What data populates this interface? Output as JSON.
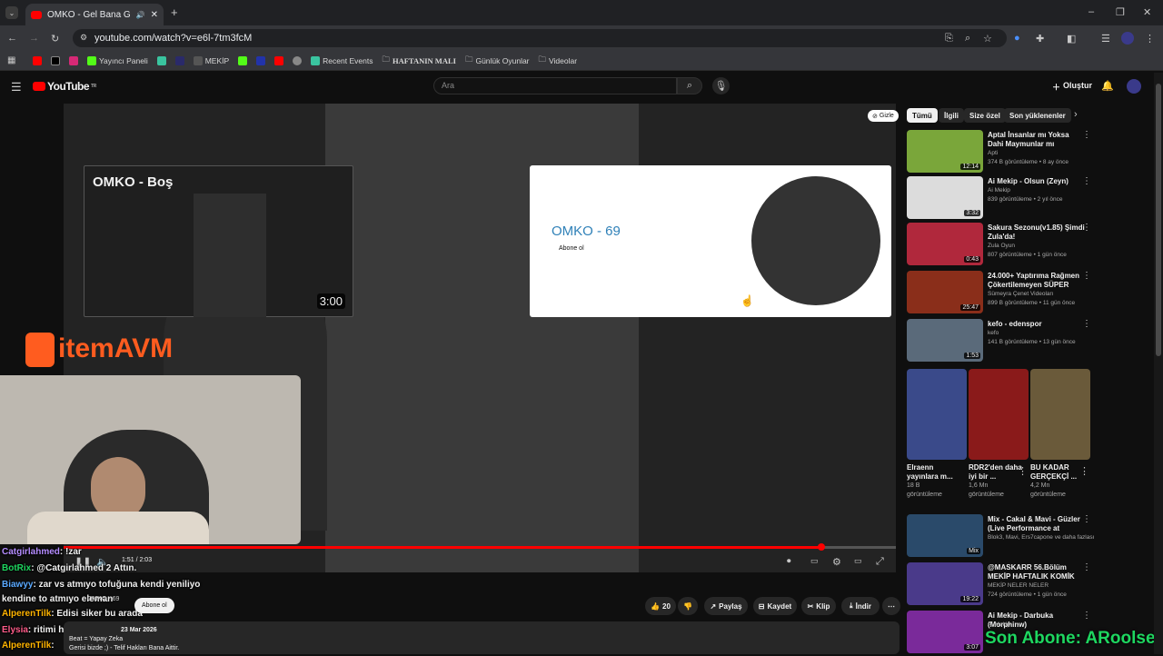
{
  "browser": {
    "tab_title": "OMKO - Gel Bana Gel - You",
    "new_tab": "+",
    "url": "youtube.com/watch?v=e6l-7tm3fcM",
    "bookmarks": [
      "Yayıncı Paneli",
      "MEKİP",
      "Recent Events",
      "HAFTANIN MALI",
      "Günlük Oyunlar",
      "Videolar"
    ]
  },
  "youtube": {
    "logo_text": "YouTube",
    "logo_sup": "TR",
    "search_placeholder": "Ara",
    "create_label": "Oluştur"
  },
  "player": {
    "hide_label": "Gizle",
    "endcard_video_title": "OMKO - Boş",
    "endcard_video_duration": "3:00",
    "endcard_channel_name": "OMKO - 69",
    "endcard_subscribe": "Abone ol",
    "time": "1:51 / 2:03",
    "progress_fraction": 0.91
  },
  "overlay": {
    "brand_item": "item",
    "brand_avm": "AVM",
    "chat": [
      {
        "user": "Catgirlahmed",
        "text": ": !zar",
        "color": "#b48cff"
      },
      {
        "user": "BotRix",
        "text": ": @Catgirlahmed 2 Attın.",
        "color": "#1ed760"
      },
      {
        "user": "Biawyy",
        "text": ": zar vs atmıyo tofuğuna kendi yeniliyo",
        "color": "#5aa9ff"
      },
      {
        "user": "",
        "text": "kendine to atmıyo eleman",
        "color": "#ffffff"
      },
      {
        "user": "AlperenTilk",
        "text": ": Edisi siker bu arada",
        "color": "#ffb400"
      },
      {
        "user": "Elysia",
        "text": ": ritimi hoşmuş",
        "color": "#ff5c8a"
      },
      {
        "user": "AlperenTilk",
        "text": ": ",
        "color": "#ffb400"
      }
    ],
    "son_abone": "Son Abone: ARoolse"
  },
  "below_video": {
    "channel": "OMKO - 69",
    "subscribe": "Abone ol",
    "likes": "20",
    "share": "Paylaş",
    "save": "Kaydet",
    "clip": "Klip",
    "download": "İndir",
    "date": "23 Mar 2026",
    "desc1": "Beat = Yapay Zeka",
    "desc2": "Gerisi bizde ;) - Telif Hakları Bana Aittir."
  },
  "sidebar": {
    "chips": [
      "Tümü",
      "İlgili",
      "Size özel",
      "Son yüklenenler"
    ],
    "recommendations": [
      {
        "title": "Aptal İnsanlar mı Yoksa Dahi Maymunlar mı Kazanır? | ...",
        "channel": "Apti",
        "meta": "374 B görüntüleme • 8 ay önce",
        "duration": "12:14",
        "color": "#7aa63a"
      },
      {
        "title": "Ai Mekip - Olsun (Zeyn)",
        "channel": "Ai Mekip",
        "meta": "839 görüntüleme • 2 yıl önce",
        "duration": "3:32",
        "color": "#dcdcdc"
      },
      {
        "title": "Sakura Sezonu(v1.85) Şimdi Zula'da!",
        "channel": "Zula Oyun",
        "meta": "807 görüntüleme • 1 gün önce",
        "duration": "0:43",
        "color": "#b0283c"
      },
      {
        "title": "24.000+ Yaptırıma Rağmen Çökertilemeyen SÜPER Güç: ...",
        "channel": "Sümeyra Çenet Videoları",
        "meta": "899 B görüntüleme • 11 gün önce",
        "duration": "25:47",
        "color": "#8a2e1a"
      },
      {
        "title": "kefo - edenspor",
        "channel": "kefo",
        "meta": "141 B görüntüleme • 13 gün önce",
        "duration": "1:53",
        "color": "#5a6a7a"
      }
    ],
    "shorts": [
      {
        "title": "Elraenn yayınlara m...",
        "meta1": "18 B",
        "meta2": "görüntüleme",
        "color": "#3a4a8a"
      },
      {
        "title": "RDR2'den daha iyi bir ...",
        "meta1": "1,6 Mn",
        "meta2": "görüntüleme",
        "color": "#8a1a1a"
      },
      {
        "title": "BU KADAR GERÇEKÇİ ...",
        "meta1": "4,2 Mn",
        "meta2": "görüntüleme",
        "color": "#6a5a3a"
      }
    ],
    "recommendations2": [
      {
        "title": "Mix - Cakal & Mavi - Güzler (Live Performance at İstanbul ...",
        "channel": "Blok3, Mavi, Ers7capone ve daha fazlası",
        "meta": "",
        "duration": "Mix",
        "color": "#2a4a6a"
      },
      {
        "title": "@MASKARR 56.Bölüm MEKİP HAFTALIK KOMİK ANLAR ...",
        "channel": "MEKİP NELER NELER",
        "meta": "724 görüntüleme • 1 gün önce",
        "duration": "19:22",
        "color": "#4a3a8a"
      },
      {
        "title": "Ai Mekip - Darbuka (Morphinw)",
        "channel": "Ai Mekip",
        "meta": "",
        "duration": "3:07",
        "color": "#7a2a9a"
      }
    ]
  }
}
